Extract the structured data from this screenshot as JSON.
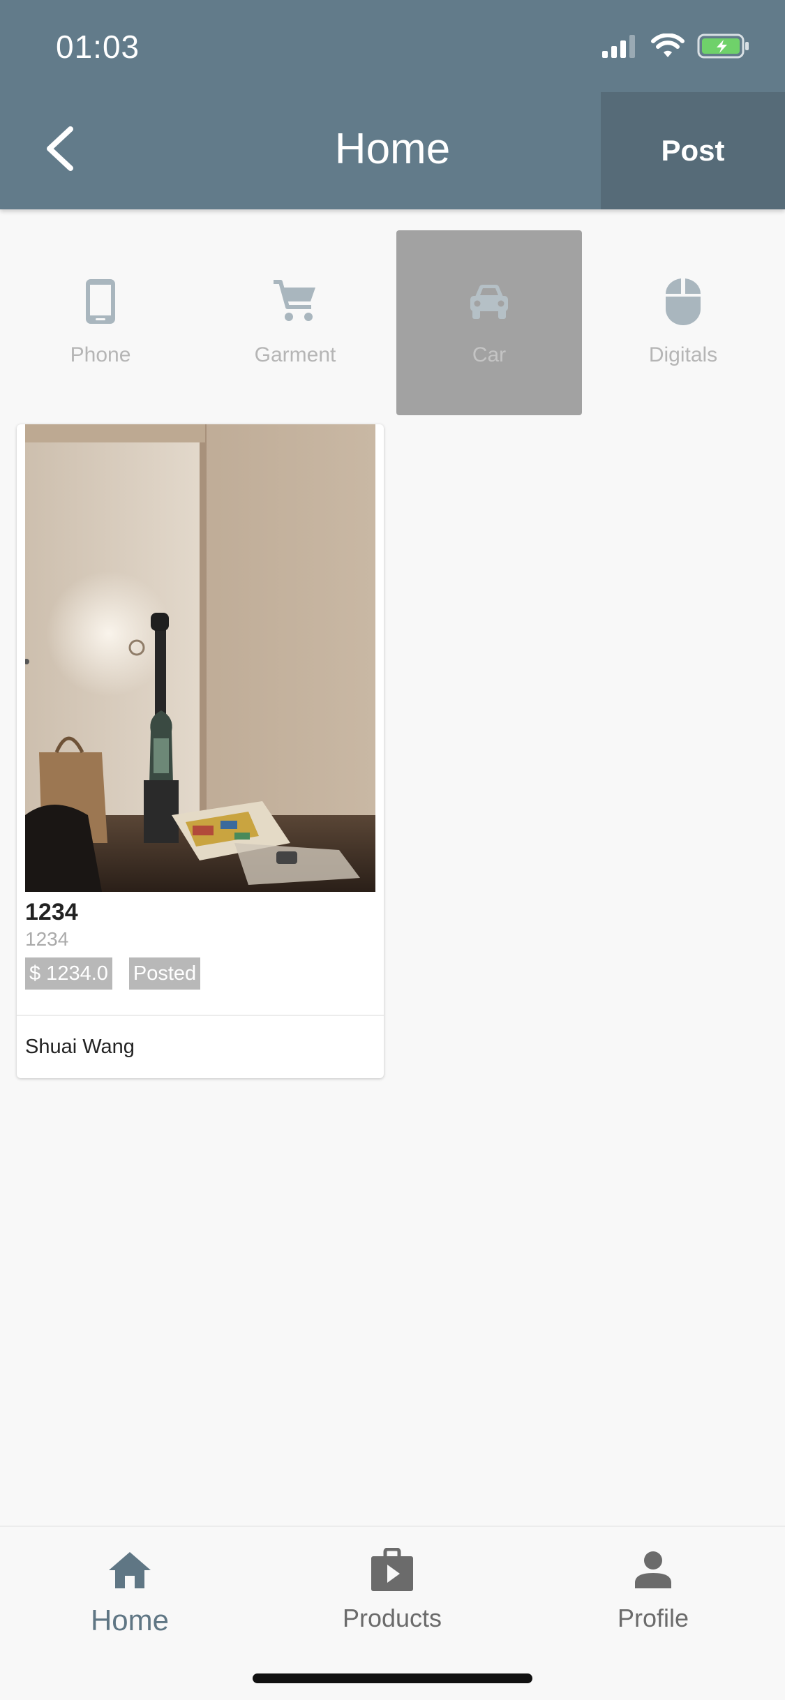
{
  "status_bar": {
    "time": "01:03"
  },
  "header": {
    "title": "Home",
    "post_label": "Post"
  },
  "categories": [
    {
      "label": "Phone",
      "icon": "phone-icon",
      "selected": false
    },
    {
      "label": "Garment",
      "icon": "cart-icon",
      "selected": false
    },
    {
      "label": "Car",
      "icon": "car-icon",
      "selected": true
    },
    {
      "label": "Digitals",
      "icon": "mouse-icon",
      "selected": false
    }
  ],
  "products": [
    {
      "title": "1234",
      "subtitle": "1234",
      "price": "$ 1234.0",
      "status": "Posted",
      "author": "Shuai Wang"
    }
  ],
  "tabbar": {
    "items": [
      {
        "label": "Home",
        "icon": "home-icon",
        "active": true
      },
      {
        "label": "Products",
        "icon": "shopping-bag-icon",
        "active": false
      },
      {
        "label": "Profile",
        "icon": "person-icon",
        "active": false
      }
    ]
  },
  "colors": {
    "header": "#627b8a",
    "post_button": "#566b78",
    "selected_category": "#a2a2a2",
    "active_tab": "#5f7684",
    "battery": "#6fd16a"
  }
}
